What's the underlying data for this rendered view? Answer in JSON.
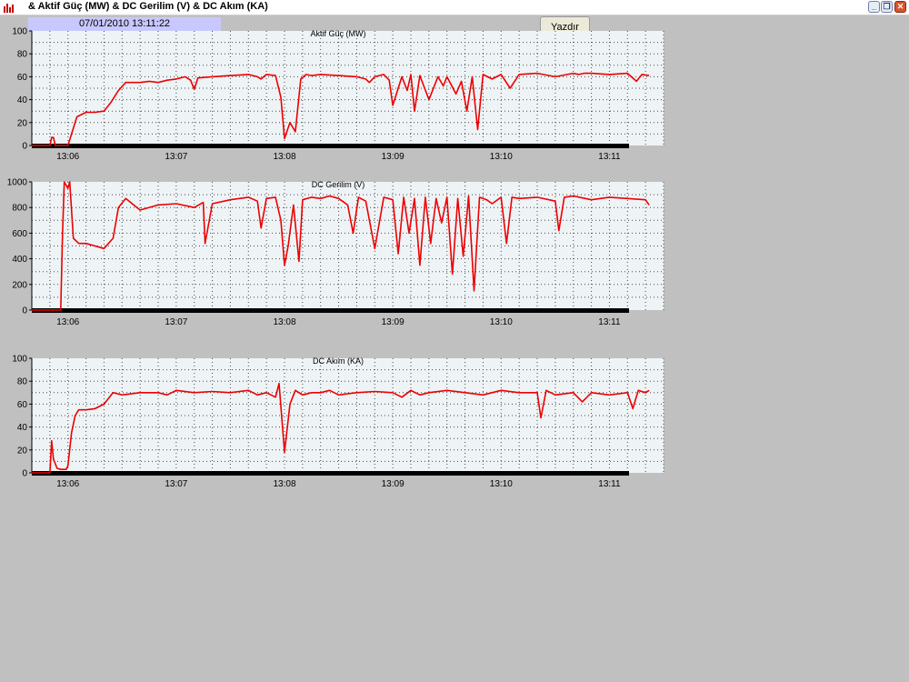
{
  "window": {
    "title": "& Aktif Güç (MW) & DC Gerilim (V) & DC Akım (KA)",
    "icon": "bar-chart-icon"
  },
  "header": {
    "datetime": "07/01/2010 13:11:22",
    "print_label": "Yazdır"
  },
  "colors": {
    "series": "#ee0000",
    "plot_background": "#eef3f6",
    "baseline": "#000000",
    "datetime_background": "#c8c8ff"
  },
  "chart_data": [
    {
      "type": "line",
      "title": "Aktif Güç (MW)",
      "ylim": [
        0,
        100
      ],
      "yticks": [
        0,
        20,
        40,
        60,
        80,
        100
      ],
      "xlim": [
        "13:05:40",
        "13:11:30"
      ],
      "xticks": [
        "13:06",
        "13:07",
        "13:08",
        "13:09",
        "13:10",
        "13:11"
      ],
      "grid": true,
      "series": [
        {
          "color": "#ee0000",
          "x": [
            "13:05:40",
            "13:05:50",
            "13:05:51",
            "13:05:52",
            "13:05:53",
            "13:06:00",
            "13:06:02",
            "13:06:05",
            "13:06:10",
            "13:06:15",
            "13:06:20",
            "13:06:24",
            "13:06:28",
            "13:06:32",
            "13:06:36",
            "13:06:40",
            "13:06:45",
            "13:06:50",
            "13:06:55",
            "13:07:00",
            "13:07:05",
            "13:07:08",
            "13:07:10",
            "13:07:12",
            "13:07:20",
            "13:07:30",
            "13:07:40",
            "13:07:45",
            "13:07:47",
            "13:07:50",
            "13:07:55",
            "13:07:58",
            "13:08:00",
            "13:08:03",
            "13:08:06",
            "13:08:09",
            "13:08:12",
            "13:08:15",
            "13:08:20",
            "13:08:30",
            "13:08:40",
            "13:08:45",
            "13:08:47",
            "13:08:50",
            "13:08:55",
            "13:08:58",
            "13:09:00",
            "13:09:05",
            "13:09:08",
            "13:09:10",
            "13:09:12",
            "13:09:15",
            "13:09:20",
            "13:09:25",
            "13:09:28",
            "13:09:30",
            "13:09:35",
            "13:09:38",
            "13:09:41",
            "13:09:44",
            "13:09:47",
            "13:09:50",
            "13:09:55",
            "13:10:00",
            "13:10:05",
            "13:10:10",
            "13:10:20",
            "13:10:30",
            "13:10:40",
            "13:10:43",
            "13:10:46",
            "13:10:50",
            "13:11:00",
            "13:11:10",
            "13:11:15",
            "13:11:18",
            "13:11:22"
          ],
          "y": [
            0,
            0,
            7,
            7,
            0,
            0,
            10,
            25,
            29,
            29,
            30,
            38,
            48,
            55,
            55,
            55,
            56,
            55,
            57,
            58,
            60,
            57,
            49,
            59,
            60,
            61,
            62,
            60,
            58,
            62,
            61,
            42,
            6,
            20,
            12,
            58,
            62,
            61,
            62,
            61,
            60,
            58,
            55,
            60,
            62,
            57,
            35,
            60,
            48,
            62,
            30,
            61,
            40,
            60,
            52,
            60,
            45,
            56,
            30,
            60,
            14,
            62,
            58,
            62,
            50,
            62,
            63,
            60,
            63,
            62,
            63,
            63,
            62,
            63,
            56,
            62,
            61
          ]
        }
      ]
    },
    {
      "type": "line",
      "title": "DC Gerilim (V)",
      "ylim": [
        0,
        1000
      ],
      "yticks": [
        0,
        200,
        400,
        600,
        800,
        1000
      ],
      "xlim": [
        "13:05:40",
        "13:11:30"
      ],
      "xticks": [
        "13:06",
        "13:07",
        "13:08",
        "13:09",
        "13:10",
        "13:11"
      ],
      "grid": true,
      "series": [
        {
          "color": "#ee0000",
          "x": [
            "13:05:40",
            "13:05:56",
            "13:05:57",
            "13:05:58",
            "13:06:00",
            "13:06:01",
            "13:06:03",
            "13:06:06",
            "13:06:10",
            "13:06:15",
            "13:06:20",
            "13:06:25",
            "13:06:28",
            "13:06:32",
            "13:06:40",
            "13:06:50",
            "13:07:00",
            "13:07:10",
            "13:07:15",
            "13:07:16",
            "13:07:20",
            "13:07:30",
            "13:07:40",
            "13:07:45",
            "13:07:47",
            "13:07:50",
            "13:07:55",
            "13:07:58",
            "13:08:00",
            "13:08:02",
            "13:08:05",
            "13:08:08",
            "13:08:10",
            "13:08:15",
            "13:08:20",
            "13:08:25",
            "13:08:30",
            "13:08:35",
            "13:08:38",
            "13:08:41",
            "13:08:45",
            "13:08:50",
            "13:08:55",
            "13:09:00",
            "13:09:03",
            "13:09:06",
            "13:09:09",
            "13:09:12",
            "13:09:15",
            "13:09:18",
            "13:09:21",
            "13:09:24",
            "13:09:27",
            "13:09:30",
            "13:09:33",
            "13:09:36",
            "13:09:39",
            "13:09:42",
            "13:09:45",
            "13:09:48",
            "13:09:52",
            "13:09:55",
            "13:10:00",
            "13:10:03",
            "13:10:06",
            "13:10:10",
            "13:10:20",
            "13:10:30",
            "13:10:32",
            "13:10:35",
            "13:10:40",
            "13:10:50",
            "13:11:00",
            "13:11:10",
            "13:11:20",
            "13:11:22"
          ],
          "y": [
            0,
            0,
            600,
            1000,
            950,
            1000,
            560,
            520,
            520,
            500,
            480,
            560,
            800,
            870,
            780,
            820,
            830,
            800,
            840,
            520,
            830,
            860,
            880,
            850,
            640,
            870,
            880,
            700,
            350,
            500,
            820,
            380,
            860,
            880,
            870,
            890,
            870,
            820,
            600,
            880,
            850,
            480,
            880,
            860,
            440,
            880,
            600,
            870,
            350,
            880,
            520,
            870,
            680,
            880,
            280,
            870,
            420,
            890,
            150,
            880,
            860,
            830,
            880,
            520,
            880,
            870,
            880,
            850,
            620,
            880,
            890,
            860,
            880,
            870,
            860,
            820
          ]
        }
      ]
    },
    {
      "type": "line",
      "title": "DC Akım (KA)",
      "ylim": [
        0,
        100
      ],
      "yticks": [
        0,
        20,
        40,
        60,
        80,
        100
      ],
      "xlim": [
        "13:05:40",
        "13:11:30"
      ],
      "xticks": [
        "13:06",
        "13:07",
        "13:08",
        "13:09",
        "13:10",
        "13:11"
      ],
      "grid": true,
      "series": [
        {
          "color": "#ee0000",
          "x": [
            "13:05:40",
            "13:05:50",
            "13:05:51",
            "13:05:52",
            "13:05:54",
            "13:05:56",
            "13:05:59",
            "13:06:00",
            "13:06:02",
            "13:06:04",
            "13:06:06",
            "13:06:10",
            "13:06:15",
            "13:06:20",
            "13:06:25",
            "13:06:30",
            "13:06:40",
            "13:06:50",
            "13:06:55",
            "13:07:00",
            "13:07:10",
            "13:07:20",
            "13:07:30",
            "13:07:40",
            "13:07:45",
            "13:07:50",
            "13:07:55",
            "13:07:57",
            "13:08:00",
            "13:08:03",
            "13:08:06",
            "13:08:10",
            "13:08:15",
            "13:08:20",
            "13:08:25",
            "13:08:30",
            "13:08:40",
            "13:08:50",
            "13:09:00",
            "13:09:05",
            "13:09:10",
            "13:09:15",
            "13:09:20",
            "13:09:30",
            "13:09:40",
            "13:09:50",
            "13:10:00",
            "13:10:10",
            "13:10:20",
            "13:10:22",
            "13:10:25",
            "13:10:30",
            "13:10:40",
            "13:10:45",
            "13:10:50",
            "13:11:00",
            "13:11:10",
            "13:11:13",
            "13:11:16",
            "13:11:20",
            "13:11:22"
          ],
          "y": [
            0,
            0,
            28,
            12,
            4,
            3,
            3,
            6,
            35,
            50,
            55,
            55,
            56,
            60,
            70,
            68,
            70,
            70,
            68,
            72,
            70,
            71,
            70,
            72,
            68,
            70,
            66,
            78,
            18,
            60,
            72,
            68,
            70,
            70,
            72,
            68,
            70,
            71,
            70,
            66,
            72,
            68,
            70,
            72,
            70,
            68,
            72,
            70,
            70,
            48,
            72,
            68,
            70,
            62,
            70,
            68,
            70,
            56,
            72,
            70,
            72
          ]
        }
      ]
    }
  ]
}
